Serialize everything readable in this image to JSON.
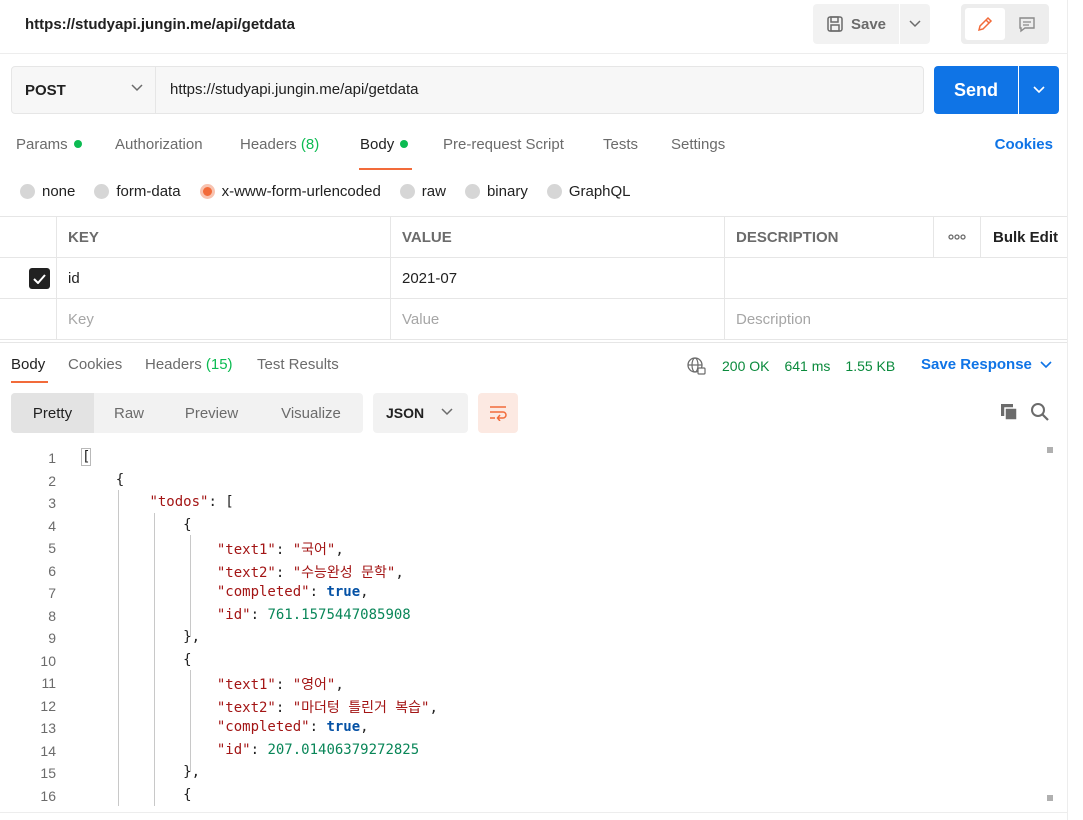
{
  "tab": {
    "url": "https://studyapi.jungin.me/api/getdata"
  },
  "toolbar": {
    "save_label": "Save"
  },
  "request": {
    "method": "POST",
    "url": "https://studyapi.jungin.me/api/getdata",
    "send_label": "Send",
    "tabs": [
      {
        "label": "Params",
        "dot": true
      },
      {
        "label": "Authorization"
      },
      {
        "label": "Headers",
        "count": "(8)"
      },
      {
        "label": "Body",
        "dot": true,
        "active": true
      },
      {
        "label": "Pre-request Script"
      },
      {
        "label": "Tests"
      },
      {
        "label": "Settings"
      }
    ],
    "cookies_label": "Cookies",
    "body_types": [
      "none",
      "form-data",
      "x-www-form-urlencoded",
      "raw",
      "binary",
      "GraphQL"
    ],
    "body_type_selected": "x-www-form-urlencoded",
    "table": {
      "headers": {
        "key": "KEY",
        "value": "VALUE",
        "description": "DESCRIPTION",
        "bulk_edit": "Bulk Edit"
      },
      "rows": [
        {
          "checked": true,
          "key": "id",
          "value": "2021-07",
          "description": ""
        }
      ],
      "placeholders": {
        "key": "Key",
        "value": "Value",
        "description": "Description"
      }
    }
  },
  "response": {
    "tabs": [
      {
        "label": "Body",
        "active": true
      },
      {
        "label": "Cookies"
      },
      {
        "label": "Headers",
        "count": "(15)"
      },
      {
        "label": "Test Results"
      }
    ],
    "status": "200 OK",
    "time": "641 ms",
    "size": "1.55 KB",
    "save_response_label": "Save Response",
    "views": [
      "Pretty",
      "Raw",
      "Preview",
      "Visualize"
    ],
    "format": "JSON",
    "code_lines": [
      {
        "n": "1",
        "text": "["
      },
      {
        "n": "2",
        "text": "    {"
      },
      {
        "n": "3",
        "text": "        \"todos\": ["
      },
      {
        "n": "4",
        "text": "            {"
      },
      {
        "n": "5",
        "text": "                \"text1\": \"국어\","
      },
      {
        "n": "6",
        "text": "                \"text2\": \"수능완성 문학\","
      },
      {
        "n": "7",
        "text": "                \"completed\": true,"
      },
      {
        "n": "8",
        "text": "                \"id\": 761.1575447085908"
      },
      {
        "n": "9",
        "text": "            },"
      },
      {
        "n": "10",
        "text": "            {"
      },
      {
        "n": "11",
        "text": "                \"text1\": \"영어\","
      },
      {
        "n": "12",
        "text": "                \"text2\": \"마더텅 틀린거 복습\","
      },
      {
        "n": "13",
        "text": "                \"completed\": true,"
      },
      {
        "n": "14",
        "text": "                \"id\": 207.01406379272825"
      },
      {
        "n": "15",
        "text": "            },"
      },
      {
        "n": "16",
        "text": "            {"
      }
    ]
  },
  "colors": {
    "accent": "#f26b3a",
    "primary": "#0f74e6",
    "success": "#0cbb52"
  }
}
